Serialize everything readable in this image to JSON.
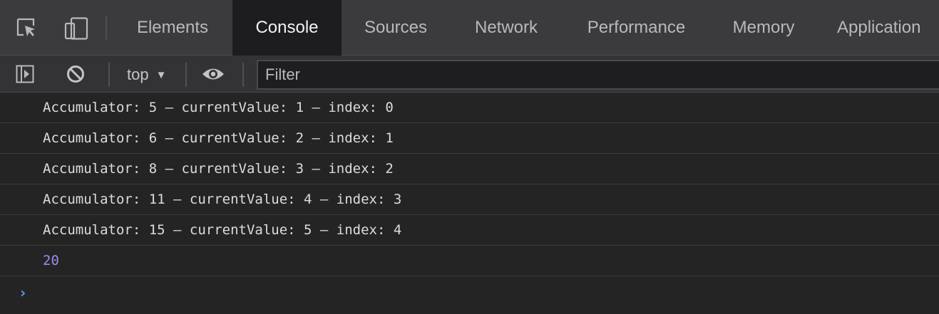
{
  "tabbar": {
    "tools": [
      {
        "icon": "inspect-element-icon"
      },
      {
        "icon": "device-toolbar-icon"
      }
    ],
    "tabs": [
      {
        "label": "Elements",
        "active": false
      },
      {
        "label": "Console",
        "active": true
      },
      {
        "label": "Sources",
        "active": false
      },
      {
        "label": "Network",
        "active": false
      },
      {
        "label": "Performance",
        "active": false
      },
      {
        "label": "Memory",
        "active": false
      },
      {
        "label": "Application",
        "active": false
      }
    ]
  },
  "toolbar": {
    "context": "top",
    "caret": "▼",
    "filter_placeholder": "Filter"
  },
  "console": {
    "messages": [
      {
        "text": "Accumulator: 5 – currentValue: 1 – index: 0",
        "type": "log"
      },
      {
        "text": "Accumulator: 6 – currentValue: 2 – index: 1",
        "type": "log"
      },
      {
        "text": "Accumulator: 8 – currentValue: 3 – index: 2",
        "type": "log"
      },
      {
        "text": "Accumulator: 11 – currentValue: 4 – index: 3",
        "type": "log"
      },
      {
        "text": "Accumulator: 15 – currentValue: 5 – index: 4",
        "type": "log"
      },
      {
        "text": "20",
        "type": "result"
      }
    ],
    "prompt": "›"
  },
  "colors": {
    "tab_background": "#3b3b3e",
    "active_tab_background": "#1d1d1f",
    "console_background": "#242424",
    "result_color": "#9e8cf2",
    "prompt_color": "#4fa8ff"
  }
}
